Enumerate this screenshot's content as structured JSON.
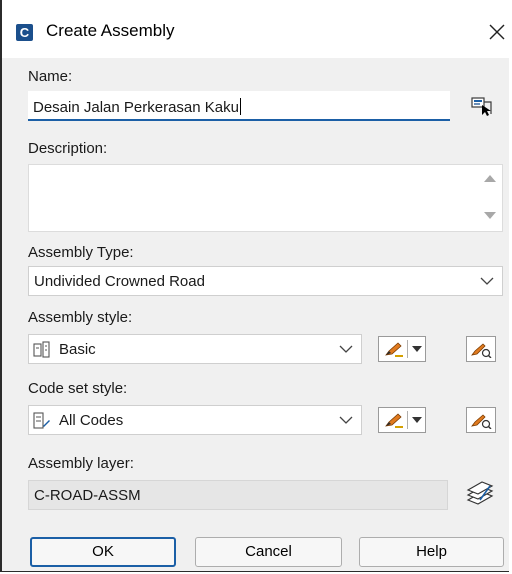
{
  "dialog": {
    "title": "Create Assembly",
    "app_icon_letter": "C"
  },
  "name": {
    "label": "Name:",
    "value": "Desain Jalan Perkerasan Kaku"
  },
  "description": {
    "label": "Description:",
    "value": ""
  },
  "assembly_type": {
    "label": "Assembly Type:",
    "selected": "Undivided Crowned Road"
  },
  "assembly_style": {
    "label": "Assembly style:",
    "selected": "Basic"
  },
  "code_set_style": {
    "label": "Code set style:",
    "selected": "All Codes"
  },
  "assembly_layer": {
    "label": "Assembly layer:",
    "value": "C-ROAD-ASSM"
  },
  "buttons": {
    "ok": "OK",
    "cancel": "Cancel",
    "help": "Help"
  },
  "colors": {
    "accent": "#1b5fa6",
    "icon_blue": "#1b4f8c",
    "pen_orange": "#e07a1f"
  },
  "icons": {
    "close": "close-icon",
    "pick": "pick-from-drawing-icon",
    "assembly_style": "assembly-style-icon",
    "code_set": "code-set-icon",
    "edit_style": "edit-style-pen-icon",
    "view_style": "view-style-icon",
    "layer": "layer-icon"
  }
}
